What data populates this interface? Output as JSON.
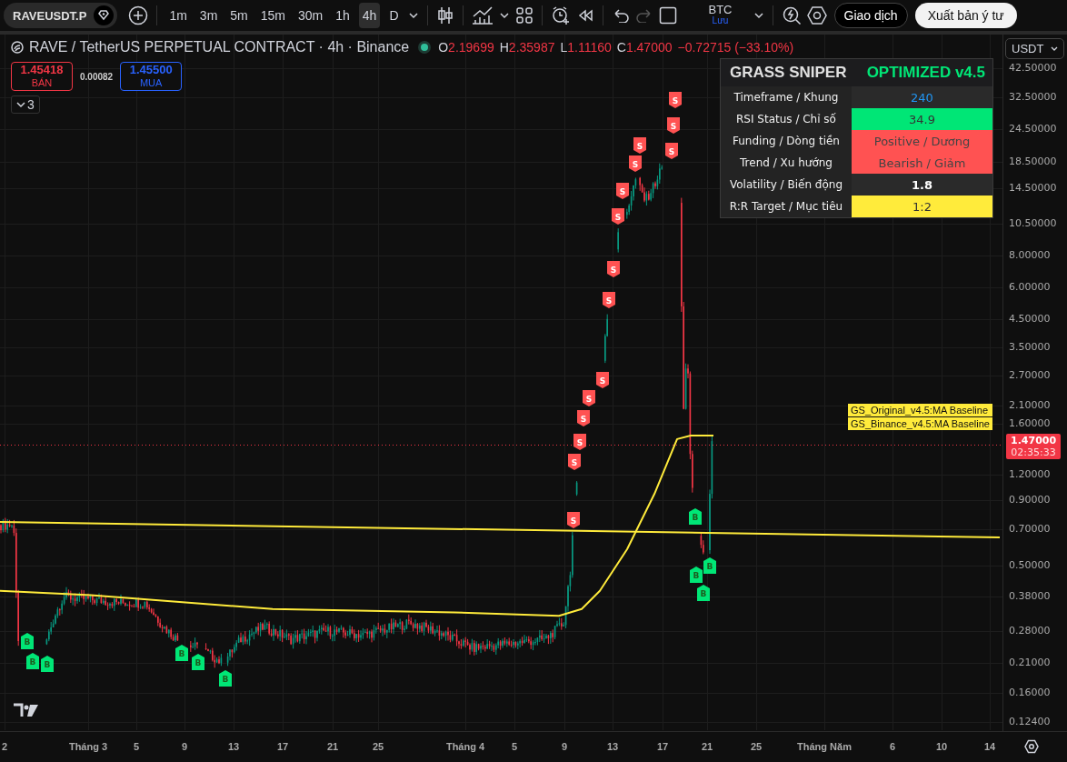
{
  "toolbar": {
    "symbol": "RAVEUSDT.P",
    "intervals": [
      {
        "label": "1m",
        "selected": false
      },
      {
        "label": "3m",
        "selected": false
      },
      {
        "label": "5m",
        "selected": false
      },
      {
        "label": "15m",
        "selected": false
      },
      {
        "label": "30m",
        "selected": false
      },
      {
        "label": "1h",
        "selected": false
      },
      {
        "label": "4h",
        "selected": true
      },
      {
        "label": "D",
        "selected": false
      }
    ],
    "compare": {
      "label": "BTC",
      "sub": "Lưu"
    },
    "trade_button": "Giao dịch",
    "publish_button": "Xuất bản ý tư"
  },
  "legend": {
    "title": "RAVE / TetherUS PERPETUAL CONTRACT · 4h · Binance",
    "ohlc": [
      {
        "key": "O",
        "value": "2.19699"
      },
      {
        "key": "H",
        "value": "2.35987"
      },
      {
        "key": "L",
        "value": "1.11160"
      },
      {
        "key": "C",
        "value": "1.47000"
      }
    ],
    "change": "−0.72715 (−33.10%)"
  },
  "order": {
    "sell_price": "1.45418",
    "sell_label": "BÁN",
    "spread": "0.00082",
    "buy_price": "1.45500",
    "buy_label": "MUA"
  },
  "indicators_toggle": "3",
  "panel": {
    "title": "GRASS SNIPER",
    "subtitle": "OPTIMIZED v4.5",
    "rows": [
      {
        "label": "Timeframe / Khung",
        "value": "240",
        "kind": "info"
      },
      {
        "label": "RSI Status / Chỉ số",
        "value": "34.9",
        "kind": "positive"
      },
      {
        "label": "Funding / Dòng tiền",
        "value": "Positive / Dương",
        "kind": "negative"
      },
      {
        "label": "Trend / Xu hướng",
        "value": "Bearish / Giảm",
        "kind": "negative"
      },
      {
        "label": "Volatility / Biến động",
        "value": "1.8",
        "kind": "plain"
      },
      {
        "label": "R:R Target / Mục tiêu",
        "value": "1:2",
        "kind": "target"
      }
    ]
  },
  "markers": [
    {
      "kind": "buy",
      "label": "B"
    },
    {
      "kind": "buy",
      "label": "B"
    },
    {
      "kind": "buy",
      "label": "B"
    },
    {
      "kind": "buy",
      "label": "B"
    },
    {
      "kind": "buy",
      "label": "B"
    },
    {
      "kind": "buy",
      "label": "B"
    },
    {
      "kind": "sell",
      "label": "S"
    },
    {
      "kind": "sell",
      "label": "S"
    },
    {
      "kind": "sell",
      "label": "S"
    },
    {
      "kind": "sell",
      "label": "S"
    },
    {
      "kind": "sell",
      "label": "S"
    },
    {
      "kind": "sell",
      "label": "S"
    },
    {
      "kind": "sell",
      "label": "S"
    },
    {
      "kind": "sell",
      "label": "S"
    },
    {
      "kind": "sell",
      "label": "S"
    },
    {
      "kind": "sell",
      "label": "S"
    },
    {
      "kind": "sell",
      "label": "S"
    },
    {
      "kind": "sell",
      "label": "S"
    },
    {
      "kind": "sell",
      "label": "S"
    },
    {
      "kind": "sell",
      "label": "S"
    },
    {
      "kind": "sell",
      "label": "S"
    },
    {
      "kind": "buy",
      "label": "B"
    },
    {
      "kind": "buy",
      "label": "B"
    },
    {
      "kind": "buy",
      "label": "B"
    },
    {
      "kind": "buy",
      "label": "B"
    }
  ],
  "line_labels": [
    "GS_Original_v4.5:MA Baseline",
    "GS_Binance_v4.5:MA Baseline"
  ],
  "price_axis": {
    "currency": "USDT",
    "ticks": [
      "42.50000",
      "32.50000",
      "24.50000",
      "18.50000",
      "14.50000",
      "10.50000",
      "8.00000",
      "6.00000",
      "4.50000",
      "3.50000",
      "2.70000",
      "2.10000",
      "1.60000",
      "1.20000",
      "0.90000",
      "0.70000",
      "0.50000",
      "0.38000",
      "0.28000",
      "0.21000",
      "0.16000",
      "0.12400"
    ],
    "last_price": "1.47000",
    "countdown": "02:35:33"
  },
  "time_axis": {
    "ticks": [
      "2",
      "Tháng 3",
      "5",
      "9",
      "13",
      "17",
      "21",
      "25",
      "Tháng 4",
      "5",
      "9",
      "13",
      "17",
      "21",
      "25",
      "Tháng Năm",
      "6",
      "10",
      "14"
    ]
  }
}
